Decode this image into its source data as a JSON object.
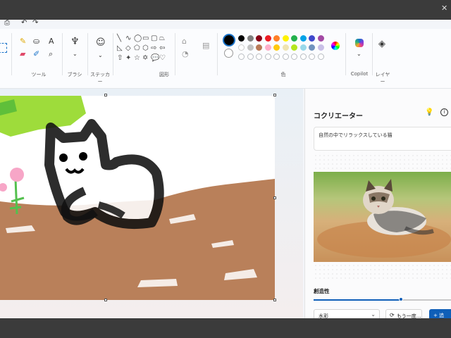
{
  "ribbon": {
    "tools_label": "ツール",
    "brushes_label": "ブラシ",
    "stickers_label": "ステッカー",
    "shapes_label": "図形",
    "colors_label": "色",
    "copilot_label": "Copilot",
    "layers_label": "レイヤー"
  },
  "palette": {
    "current": "#000000",
    "row1": [
      "#000000",
      "#7f7f7f",
      "#880015",
      "#ed1c24",
      "#ff7f27",
      "#fff200",
      "#22b14c",
      "#00a2e8",
      "#3f48cc",
      "#a349a4"
    ],
    "row2": [
      "#ffffff",
      "#c3c3c3",
      "#b97a57",
      "#ffaec9",
      "#ffc90e",
      "#efe4b0",
      "#b5e61d",
      "#99d9ea",
      "#7092be",
      "#c8bfe7"
    ]
  },
  "panel": {
    "title": "コクリエーター",
    "prompt": "自然の中でリラックスしている猫",
    "creativity_label": "創造性",
    "creativity_value": 0.62,
    "style_value": "水彩",
    "retry_label": "もう一度...",
    "create_label": "+ 追"
  },
  "icons": {
    "lightbulb": "lightbulb-icon",
    "info": "info-icon",
    "retry": "refresh-icon",
    "chevron": "chevron-down-icon"
  }
}
